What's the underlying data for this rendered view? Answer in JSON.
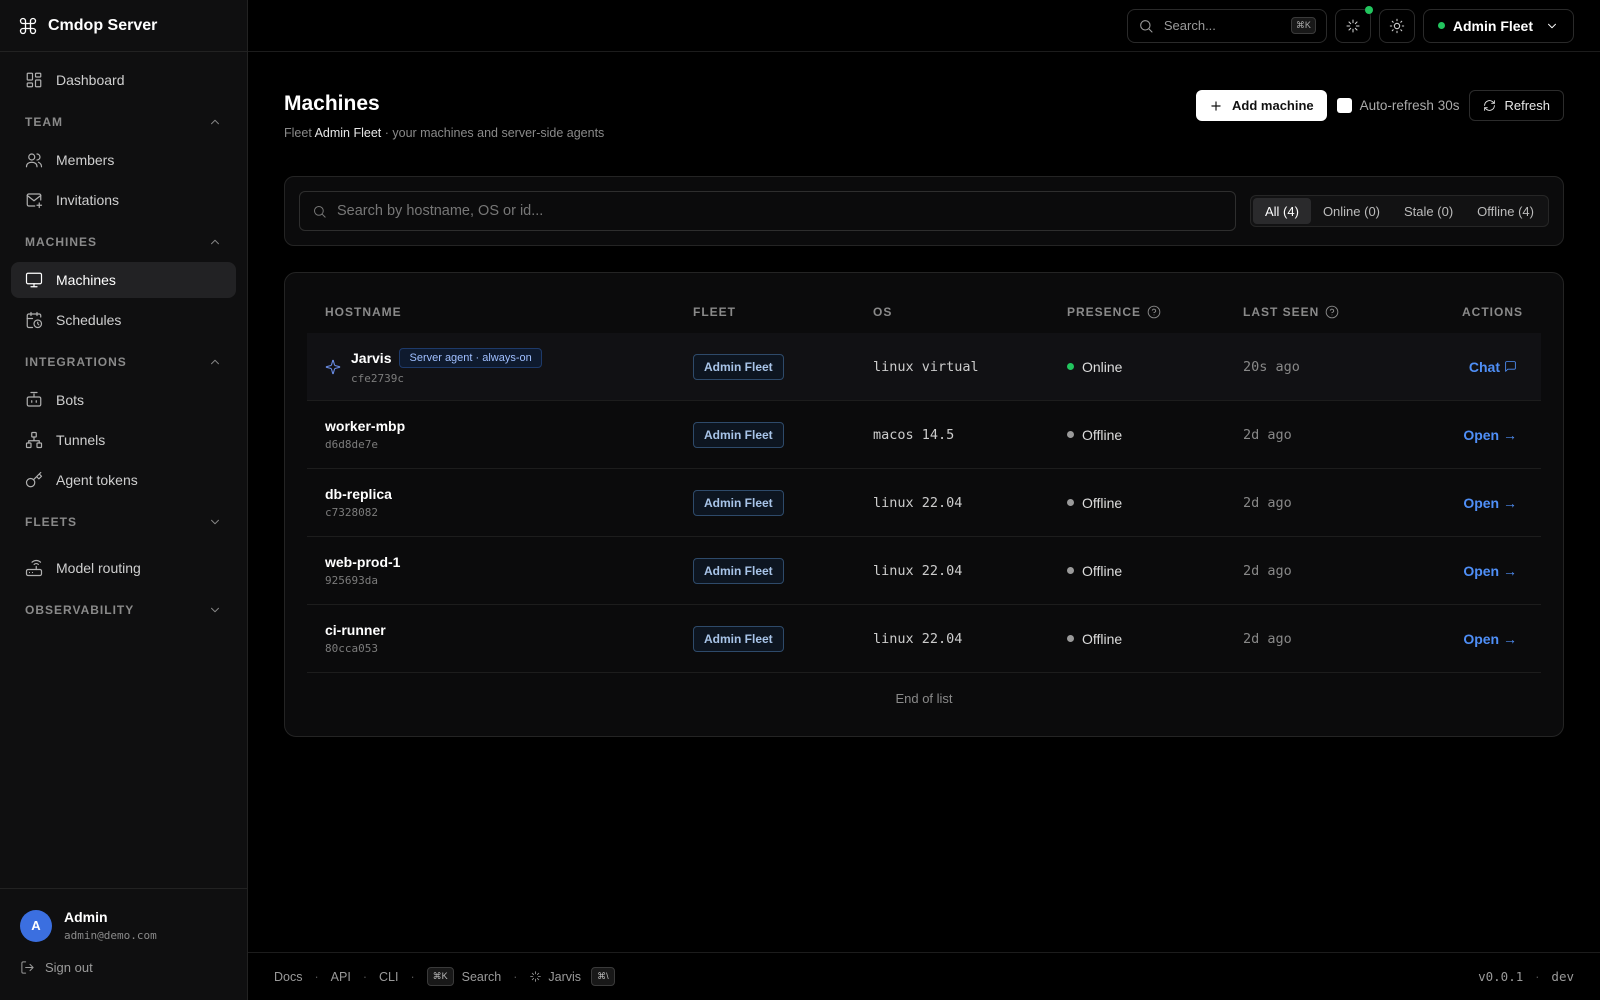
{
  "app": {
    "title": "Cmdop Server"
  },
  "sidebar": {
    "dashboard": "Dashboard",
    "sections": [
      {
        "label": "TEAM",
        "items": [
          "Members",
          "Invitations"
        ]
      },
      {
        "label": "MACHINES",
        "items": [
          "Machines",
          "Schedules"
        ]
      },
      {
        "label": "INTEGRATIONS",
        "items": [
          "Bots",
          "Tunnels",
          "Agent tokens"
        ]
      },
      {
        "label": "FLEETS",
        "items": [
          "Model routing"
        ]
      },
      {
        "label": "OBSERVABILITY",
        "items": []
      }
    ],
    "active_item": "Machines",
    "user": {
      "initial": "A",
      "name": "Admin",
      "email": "admin@demo.com"
    },
    "sign_out": "Sign out"
  },
  "topbar": {
    "search_placeholder": "Search...",
    "search_kbd": "⌘K",
    "fleet": "Admin Fleet"
  },
  "page": {
    "title": "Machines",
    "subtitle_prefix": "Fleet ",
    "subtitle_fleet": "Admin Fleet",
    "subtitle_suffix": " · your machines and server-side agents",
    "add_button": "Add machine",
    "auto_refresh": "Auto-refresh 30s",
    "refresh_button": "Refresh"
  },
  "filters": {
    "search_placeholder": "Search by hostname, OS or id...",
    "tabs": [
      "All (4)",
      "Online (0)",
      "Stale (0)",
      "Offline (4)"
    ],
    "active_tab": "All (4)"
  },
  "table": {
    "headers": {
      "hostname": "HOSTNAME",
      "fleet": "FLEET",
      "os": "OS",
      "presence": "PRESENCE",
      "last_seen": "LAST SEEN",
      "actions": "ACTIONS"
    },
    "rows": [
      {
        "hostname": "Jarvis",
        "id": "cfe2739c",
        "badge": "Server agent · always-on",
        "fleet": "Admin Fleet",
        "os": "linux virtual",
        "presence": "Online",
        "last_seen": "20s ago",
        "action": "Chat"
      },
      {
        "hostname": "worker-mbp",
        "id": "d6d8de7e",
        "badge": "",
        "fleet": "Admin Fleet",
        "os": "macos 14.5",
        "presence": "Offline",
        "last_seen": "2d ago",
        "action": "Open →"
      },
      {
        "hostname": "db-replica",
        "id": "c7328082",
        "badge": "",
        "fleet": "Admin Fleet",
        "os": "linux 22.04",
        "presence": "Offline",
        "last_seen": "2d ago",
        "action": "Open →"
      },
      {
        "hostname": "web-prod-1",
        "id": "925693da",
        "badge": "",
        "fleet": "Admin Fleet",
        "os": "linux 22.04",
        "presence": "Offline",
        "last_seen": "2d ago",
        "action": "Open →"
      },
      {
        "hostname": "ci-runner",
        "id": "80cca053",
        "badge": "",
        "fleet": "Admin Fleet",
        "os": "linux 22.04",
        "presence": "Offline",
        "last_seen": "2d ago",
        "action": "Open →"
      }
    ],
    "end_text": "End of list"
  },
  "footer": {
    "links": [
      "Docs",
      "API",
      "CLI"
    ],
    "search_kbd": "⌘K",
    "search_label": "Search",
    "jarvis_label": "Jarvis",
    "jarvis_kbd": "⌘\\",
    "version": "v0.0.1",
    "env": "dev"
  },
  "colors": {
    "accent": "#4f8ff7",
    "online": "#22c55e",
    "offline": "#9a9a9a",
    "avatar": "#3b6fe0"
  }
}
